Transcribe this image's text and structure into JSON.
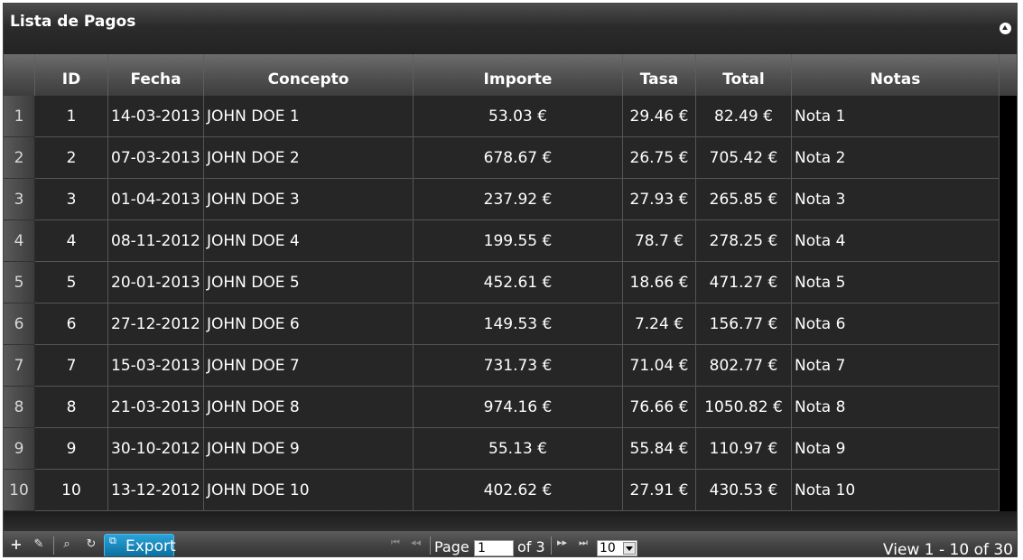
{
  "title": "Lista de Pagos",
  "columns": [
    "ID",
    "Fecha",
    "Concepto",
    "Importe",
    "Tasa",
    "Total",
    "Notas"
  ],
  "rows": [
    {
      "n": "1",
      "id": "1",
      "fecha": "14-03-2013",
      "concepto": "JOHN DOE 1",
      "importe": "53.03 €",
      "tasa": "29.46 €",
      "total": "82.49 €",
      "notas": "Nota 1"
    },
    {
      "n": "2",
      "id": "2",
      "fecha": "07-03-2013",
      "concepto": "JOHN DOE 2",
      "importe": "678.67 €",
      "tasa": "26.75 €",
      "total": "705.42 €",
      "notas": "Nota 2"
    },
    {
      "n": "3",
      "id": "3",
      "fecha": "01-04-2013",
      "concepto": "JOHN DOE 3",
      "importe": "237.92 €",
      "tasa": "27.93 €",
      "total": "265.85 €",
      "notas": "Nota 3"
    },
    {
      "n": "4",
      "id": "4",
      "fecha": "08-11-2012",
      "concepto": "JOHN DOE 4",
      "importe": "199.55 €",
      "tasa": "78.7 €",
      "total": "278.25 €",
      "notas": "Nota 4"
    },
    {
      "n": "5",
      "id": "5",
      "fecha": "20-01-2013",
      "concepto": "JOHN DOE 5",
      "importe": "452.61 €",
      "tasa": "18.66 €",
      "total": "471.27 €",
      "notas": "Nota 5"
    },
    {
      "n": "6",
      "id": "6",
      "fecha": "27-12-2012",
      "concepto": "JOHN DOE 6",
      "importe": "149.53 €",
      "tasa": "7.24 €",
      "total": "156.77 €",
      "notas": "Nota 6"
    },
    {
      "n": "7",
      "id": "7",
      "fecha": "15-03-2013",
      "concepto": "JOHN DOE 7",
      "importe": "731.73 €",
      "tasa": "71.04 €",
      "total": "802.77 €",
      "notas": "Nota 7"
    },
    {
      "n": "8",
      "id": "8",
      "fecha": "21-03-2013",
      "concepto": "JOHN DOE 8",
      "importe": "974.16 €",
      "tasa": "76.66 €",
      "total": "1050.82 €",
      "notas": "Nota 8"
    },
    {
      "n": "9",
      "id": "9",
      "fecha": "30-10-2012",
      "concepto": "JOHN DOE 9",
      "importe": "55.13 €",
      "tasa": "55.84 €",
      "total": "110.97 €",
      "notas": "Nota 9"
    },
    {
      "n": "10",
      "id": "10",
      "fecha": "13-12-2012",
      "concepto": "JOHN DOE 10",
      "importe": "402.62 €",
      "tasa": "27.91 €",
      "total": "430.53 €",
      "notas": "Nota 10"
    }
  ],
  "pager": {
    "export_label": "Export",
    "page_label": "Page",
    "page_value": "1",
    "of_label": "of 3",
    "rows_per_page": "10",
    "view_text": "View 1 - 10 of 30"
  },
  "icons": {
    "add": "add-icon",
    "edit": "edit-icon",
    "search": "search-icon",
    "refresh": "refresh-icon",
    "export": "external-link-icon",
    "collapse": "collapse-icon"
  },
  "colors": {
    "export_button": "#1b8bc2",
    "grid_background": "#262626"
  }
}
